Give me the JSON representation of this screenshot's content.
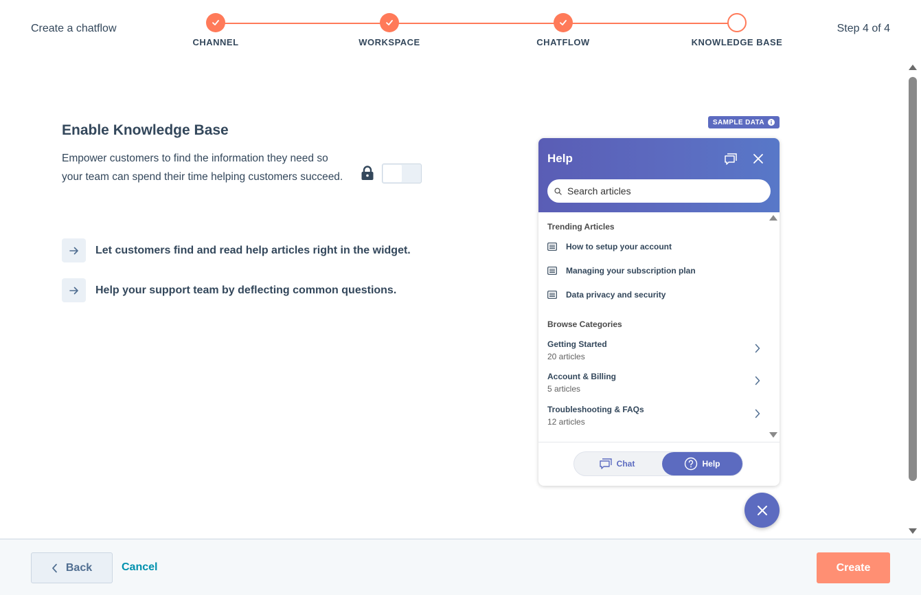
{
  "header": {
    "title": "Create a chatflow",
    "step_count": "Step 4 of 4",
    "steps": [
      {
        "label": "CHANNEL",
        "status": "done"
      },
      {
        "label": "WORKSPACE",
        "status": "done"
      },
      {
        "label": "CHATFLOW",
        "status": "done"
      },
      {
        "label": "KNOWLEDGE BASE",
        "status": "current"
      }
    ]
  },
  "main": {
    "title": "Enable Knowledge Base",
    "description": "Empower customers to find the information they need so your team can spend their time helping customers succeed.",
    "toggle_enabled": false,
    "features": [
      "Let customers find and read help articles right in the widget.",
      "Help your support team by deflecting common questions."
    ]
  },
  "widget": {
    "badge": "SAMPLE DATA",
    "title": "Help",
    "search_placeholder": "Search articles",
    "trending_label": "Trending Articles",
    "articles": [
      "How to setup your account",
      "Managing your subscription plan",
      "Data privacy and security"
    ],
    "categories_label": "Browse Categories",
    "categories": [
      {
        "name": "Getting Started",
        "count": "20 articles"
      },
      {
        "name": "Account & Billing",
        "count": "5 articles"
      },
      {
        "name": "Troubleshooting & FAQs",
        "count": "12 articles"
      }
    ],
    "tabs": {
      "chat": "Chat",
      "help": "Help"
    }
  },
  "footer": {
    "back": "Back",
    "cancel": "Cancel",
    "create": "Create"
  },
  "colors": {
    "accent": "#ff7a59",
    "widget_primary": "#5c6bc0",
    "link": "#0091ae",
    "text": "#33475b"
  }
}
